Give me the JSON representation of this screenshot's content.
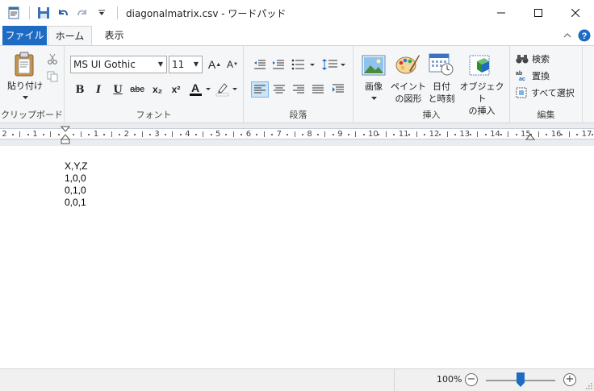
{
  "window": {
    "title": "diagonalmatrix.csv - ワードパッド"
  },
  "ribbon": {
    "tabs": [
      "ファイル",
      "ホーム",
      "表示"
    ],
    "clipboard": {
      "paste_label": "貼り付け",
      "group_label": "クリップボード"
    },
    "font": {
      "family": "MS UI Gothic",
      "size": "11",
      "group_label": "フォント",
      "bold": "B",
      "italic": "I",
      "underline": "U",
      "strike": "abc",
      "subscript": "x₂",
      "superscript": "x²"
    },
    "paragraph": {
      "group_label": "段落"
    },
    "insert": {
      "group_label": "挿入",
      "picture_label": "画像",
      "paint_label_1": "ペイント",
      "paint_label_2": "の図形",
      "datetime_label_1": "日付",
      "datetime_label_2": "と時刻",
      "object_label_1": "オブジェクト",
      "object_label_2": "の挿入"
    },
    "editing": {
      "group_label": "編集",
      "find_label": "検索",
      "replace_label": "置換",
      "select_all_label": "すべて選択"
    }
  },
  "ruler": {
    "numbers": [
      "2",
      "1",
      "1",
      "2",
      "3",
      "4",
      "5",
      "6",
      "7",
      "8",
      "9",
      "10",
      "11",
      "12",
      "13",
      "14",
      "15",
      "16",
      "17"
    ]
  },
  "document": {
    "lines": [
      "X,Y,Z",
      "1,0,0",
      "0,1,0",
      "0,0,1"
    ]
  },
  "status": {
    "zoom_level": "100%",
    "zoom_minus": "−",
    "zoom_plus": "+",
    "zoom_fraction": 0.5
  },
  "colors": {
    "accent": "#1e6bc4"
  }
}
